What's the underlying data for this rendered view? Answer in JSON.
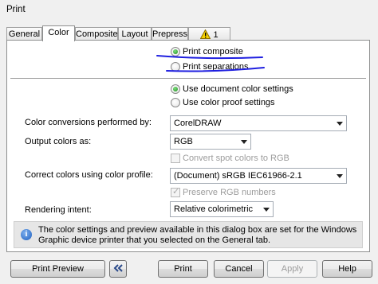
{
  "window": {
    "title": "Print"
  },
  "tabs": [
    {
      "label": "General"
    },
    {
      "label": "Color"
    },
    {
      "label": "Composite"
    },
    {
      "label": "Layout"
    },
    {
      "label": "Prepress"
    },
    {
      "label": "1 Issue"
    }
  ],
  "output_mode": {
    "print_composite": "Print composite",
    "print_separations": "Print separations",
    "selected": "Print composite"
  },
  "color_settings": {
    "use_document": "Use document color settings",
    "use_proof": "Use color proof settings",
    "selected": "Use document color settings"
  },
  "conversions": {
    "label": "Color conversions performed by:",
    "value": "CorelDRAW"
  },
  "output_colors": {
    "label": "Output colors as:",
    "value": "RGB"
  },
  "convert_spot": {
    "label": "Convert spot colors to RGB",
    "checked": false,
    "enabled": false
  },
  "correct_colors": {
    "label": "Correct colors using color profile:",
    "value": "(Document) sRGB IEC61966-2.1"
  },
  "preserve_rgb": {
    "label": "Preserve RGB numbers",
    "checked": true,
    "enabled": false
  },
  "rendering_intent": {
    "label": "Rendering intent:",
    "value": "Relative colorimetric"
  },
  "info": {
    "icon": "info-icon",
    "text": "The color settings and preview available in this dialog box are set for the Windows Graphic device printer that you selected on the General tab."
  },
  "buttons": {
    "print_preview": "Print Preview",
    "collapse_icon": "double-left-chevron-icon",
    "print": "Print",
    "cancel": "Cancel",
    "apply": "Apply",
    "help": "Help"
  },
  "colors": {
    "annotation_underline": "#1f1fe0",
    "warning_fill": "#f5d000",
    "radio_selected": "#1f8a1f"
  }
}
